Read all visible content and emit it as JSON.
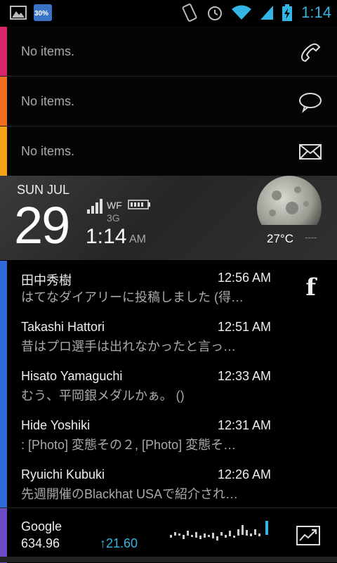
{
  "statusbar": {
    "battery_badge": "30%",
    "time": "1:14"
  },
  "rows": [
    {
      "label": "No items.",
      "icon": "phone-icon",
      "color": "#d5256b"
    },
    {
      "label": "No items.",
      "icon": "speech-bubble-icon",
      "color": "#f06d1d"
    },
    {
      "label": "No items.",
      "icon": "envelope-icon",
      "color": "#f3a21a"
    }
  ],
  "clock": {
    "day_month": "SUN JUL",
    "date": "29",
    "network": "WF",
    "network_type": "3G",
    "time": "1:14",
    "ampm": "AM",
    "temperature": "27°C",
    "temp_extra": "----"
  },
  "facebook": {
    "posts": [
      {
        "name": "田中秀樹",
        "time": "12:56 AM",
        "text": "はてなダイアリーに投稿しました (得…"
      },
      {
        "name": "Takashi Hattori",
        "time": "12:51 AM",
        "text": "昔はプロ選手は出れなかったと言っ…"
      },
      {
        "name": "Hisato  Yamaguchi",
        "time": "12:33 AM",
        "text": "むう、平岡銀メダルかぁ。 ()"
      },
      {
        "name": "Hide Yoshiki",
        "time": "12:31 AM",
        "text": ":  [Photo] 変態その２, [Photo] 変態そ…"
      },
      {
        "name": "Ryuichi Kubuki",
        "time": "12:26 AM",
        "text": "先週開催のBlackhat USAで紹介され…"
      }
    ]
  },
  "stock": {
    "name": "Google",
    "price": "634.96",
    "change": "↑21.60"
  },
  "colors": {
    "accent": "#33b5e5",
    "facebook_stripe": "#2f6bd7",
    "stock_stripe": "#6c4cc4"
  }
}
